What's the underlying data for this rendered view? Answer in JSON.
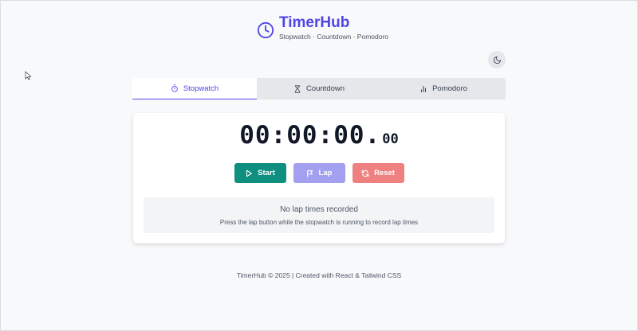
{
  "app": {
    "title": "TimerHub",
    "subtitle": "Stopwatch · Countdown · Pomodoro"
  },
  "tabs": [
    {
      "label": "Stopwatch",
      "icon": "stopwatch-icon",
      "active": true
    },
    {
      "label": "Countdown",
      "icon": "hourglass-icon",
      "active": false
    },
    {
      "label": "Pomodoro",
      "icon": "bar-chart-icon",
      "active": false
    }
  ],
  "timer": {
    "main": "00:00:00.",
    "ms": "00"
  },
  "controls": {
    "start_label": "Start",
    "lap_label": "Lap",
    "reset_label": "Reset"
  },
  "laps": {
    "empty_title": "No lap times recorded",
    "empty_hint": "Press the lap button while the stopwatch is running to record lap times"
  },
  "footer": {
    "text": "TimerHub © 2025 | Created with React & Tailwind CSS"
  },
  "colors": {
    "accent": "#4f46e5",
    "start": "#0f8f7f",
    "lap": "#a3a0f0",
    "reset": "#ef8080",
    "background": "#f8f9fb"
  }
}
